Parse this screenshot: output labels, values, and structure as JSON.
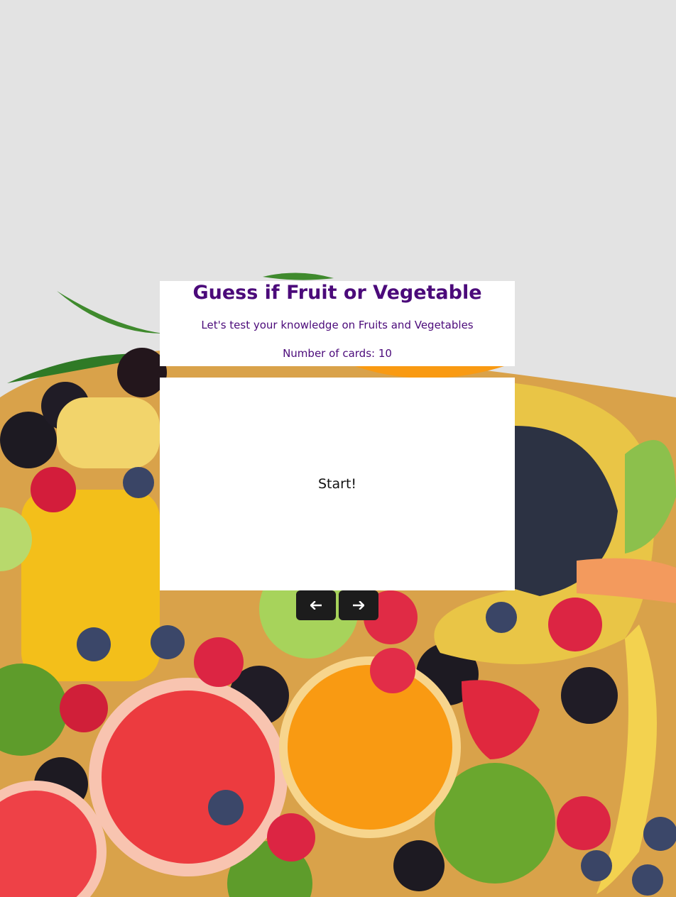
{
  "header": {
    "title": "Guess if Fruit or Vegetable",
    "subtitle": "Let's test your knowledge on Fruits and Vegetables",
    "card_count_label": "Number of cards: 10"
  },
  "card": {
    "text": "Start!"
  },
  "navigation": {
    "prev_icon": "arrow-left-icon",
    "next_icon": "arrow-right-icon"
  },
  "colors": {
    "title": "#4b0a7a",
    "page_background": "#e3e3e3",
    "nav_button": "#1c1c1c"
  }
}
